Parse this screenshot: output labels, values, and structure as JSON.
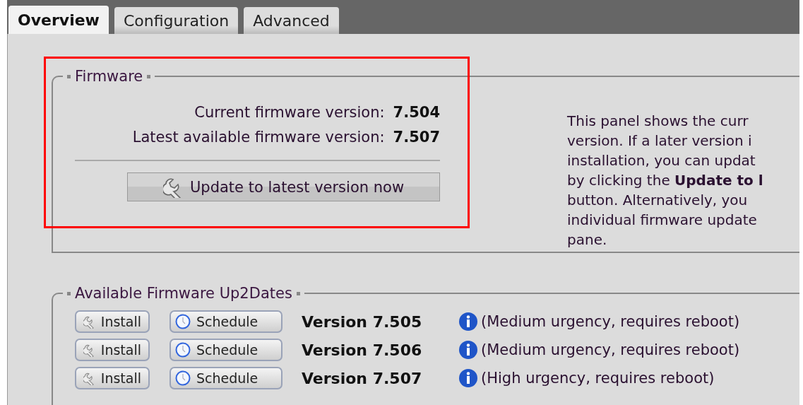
{
  "tabs": [
    {
      "label": "Overview",
      "selected": true
    },
    {
      "label": "Configuration",
      "selected": false
    },
    {
      "label": "Advanced",
      "selected": false
    }
  ],
  "firmware": {
    "legend": "Firmware",
    "rows": [
      {
        "label": "Current firmware version:",
        "value": "7.504"
      },
      {
        "label": "Latest available firmware version:",
        "value": "7.507"
      }
    ],
    "update_button": "Update to latest version now",
    "help_lines": [
      "This panel shows the curr",
      "version. If a later version i",
      "installation, you can updat",
      "by clicking the **Update to l**",
      "button. Alternatively, you",
      "individual firmware update",
      "pane."
    ]
  },
  "up2dates": {
    "legend": "Available Firmware Up2Dates",
    "rows": [
      {
        "install": "Install",
        "schedule": "Schedule",
        "version": "Version 7.505",
        "note": "(Medium urgency, requires reboot)"
      },
      {
        "install": "Install",
        "schedule": "Schedule",
        "version": "Version 7.506",
        "note": "(Medium urgency, requires reboot)"
      },
      {
        "install": "Install",
        "schedule": "Schedule",
        "version": "Version 7.507",
        "note": "(High urgency, requires reboot)"
      }
    ]
  }
}
